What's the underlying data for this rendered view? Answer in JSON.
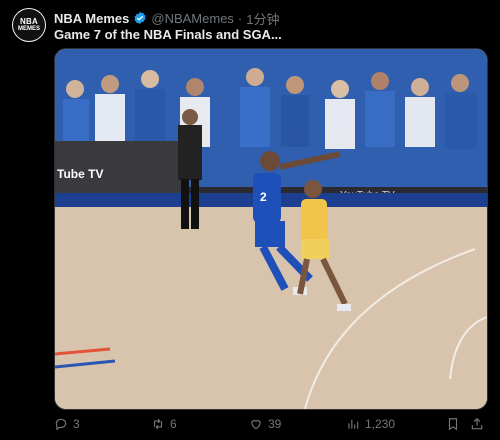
{
  "tweet": {
    "avatar_text_top": "NBA",
    "avatar_text_bottom": "MEMES",
    "display_name": "NBA Memes",
    "handle": "@NBAMemes",
    "separator": "·",
    "time": "1分钟",
    "text": "Game 7 of the NBA Finals and SGA..."
  },
  "media": {
    "arena_sign": "Tube TV",
    "baseline_sign": "YouTube TV",
    "jersey_number": "2"
  },
  "actions": {
    "replies": "3",
    "reposts": "6",
    "likes": "39",
    "views": "1,230"
  },
  "colors": {
    "verified": "#1d9bf0",
    "icon": "#71767b",
    "thunder_blue": "#1f4fb8",
    "pacers_gold": "#f0c54a"
  }
}
